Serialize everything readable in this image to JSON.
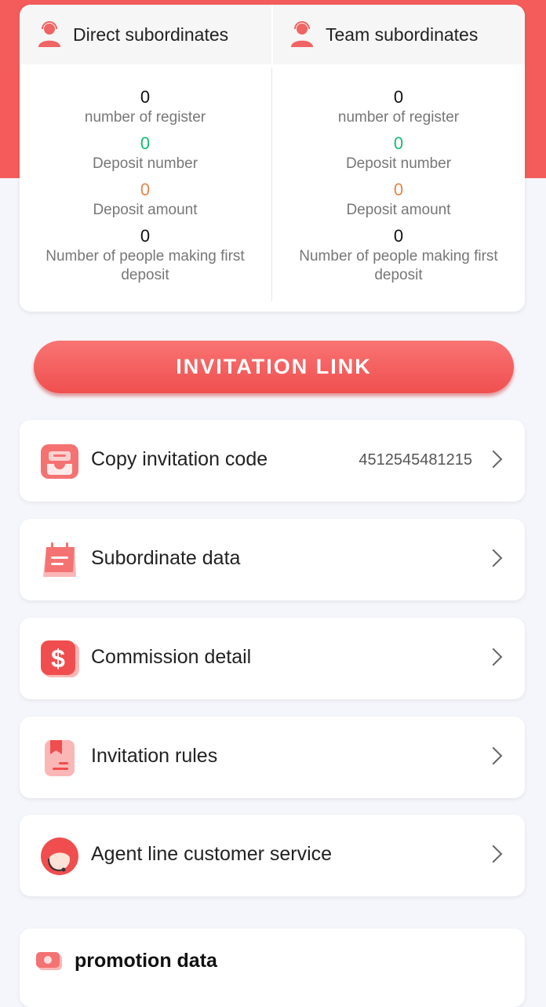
{
  "stats": {
    "direct": {
      "title": "Direct subordinates",
      "register_count": "0",
      "register_label": "number of register",
      "deposit_number": "0",
      "deposit_number_label": "Deposit number",
      "deposit_amount": "0",
      "deposit_amount_label": "Deposit amount",
      "first_deposit": "0",
      "first_deposit_label": "Number of people making first deposit"
    },
    "team": {
      "title": "Team subordinates",
      "register_count": "0",
      "register_label": "number of register",
      "deposit_number": "0",
      "deposit_number_label": "Deposit number",
      "deposit_amount": "0",
      "deposit_amount_label": "Deposit amount",
      "first_deposit": "0",
      "first_deposit_label": "Number of people making first deposit"
    }
  },
  "invite_button": {
    "label": "INVITATION LINK"
  },
  "menu": {
    "copy_code": {
      "label": "Copy invitation code",
      "value": "4512545481215",
      "icon": "inbox-icon"
    },
    "subordinate_data": {
      "label": "Subordinate data",
      "icon": "calendar-list-icon"
    },
    "commission_detail": {
      "label": "Commission detail",
      "icon": "dollar-icon"
    },
    "invitation_rules": {
      "label": "Invitation rules",
      "icon": "document-bookmark-icon"
    },
    "customer_service": {
      "label": "Agent line customer service",
      "icon": "headset-agent-icon"
    }
  },
  "promotion": {
    "title": "promotion data",
    "icon": "cash-icon"
  },
  "colors": {
    "brand": "#f45c5c",
    "green": "#18b974",
    "orange": "#e8864a"
  }
}
